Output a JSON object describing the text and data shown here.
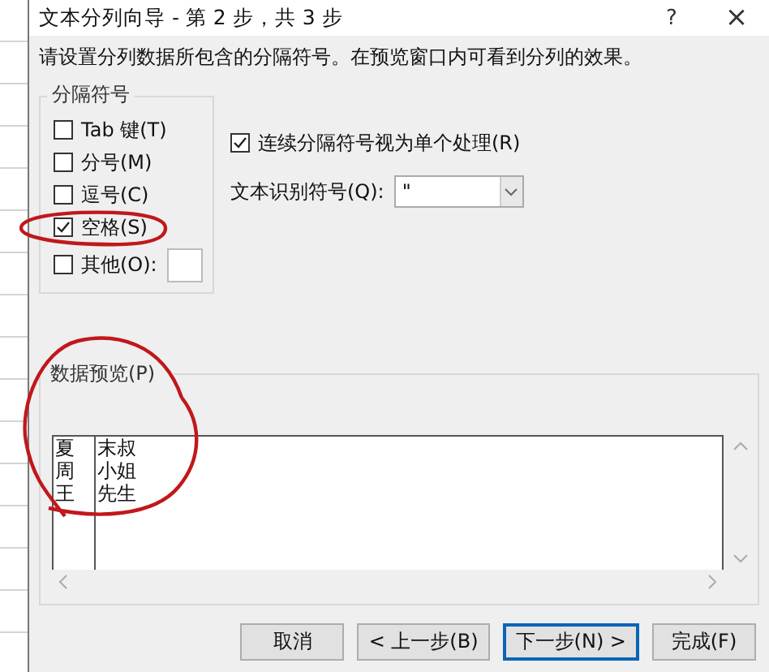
{
  "window": {
    "title": "文本分列向导 - 第 2 步，共 3 步",
    "help": "?",
    "close": "×"
  },
  "instruction": "请设置分列数据所包含的分隔符号。在预览窗口内可看到分列的效果。",
  "delimiters": {
    "label": "分隔符号",
    "items": [
      {
        "kind": "checkbox",
        "label": "Tab 键(T)",
        "checked": false
      },
      {
        "kind": "checkbox",
        "label": "分号(M)",
        "checked": false
      },
      {
        "kind": "checkbox",
        "label": "逗号(C)",
        "checked": false
      },
      {
        "kind": "checkbox",
        "label": "空格(S)",
        "checked": true
      },
      {
        "kind": "checkbox_field",
        "label": "其他(O):",
        "checked": false
      }
    ]
  },
  "consecutive": {
    "label": "连续分隔符号视为单个处理(R)",
    "checked": true
  },
  "qualifier": {
    "label": "文本识别符号(Q):",
    "value": "\""
  },
  "preview": {
    "label": "数据预览(P)",
    "rows": [
      [
        "夏",
        "末叔"
      ],
      [
        "周",
        "小姐"
      ],
      [
        "王",
        "先生"
      ]
    ]
  },
  "buttons": [
    {
      "label": "取消",
      "default": false
    },
    {
      "label": "< 上一步(B)",
      "default": false
    },
    {
      "label": "下一步(N) >",
      "default": true
    },
    {
      "label": "完成(F)",
      "default": false
    }
  ]
}
